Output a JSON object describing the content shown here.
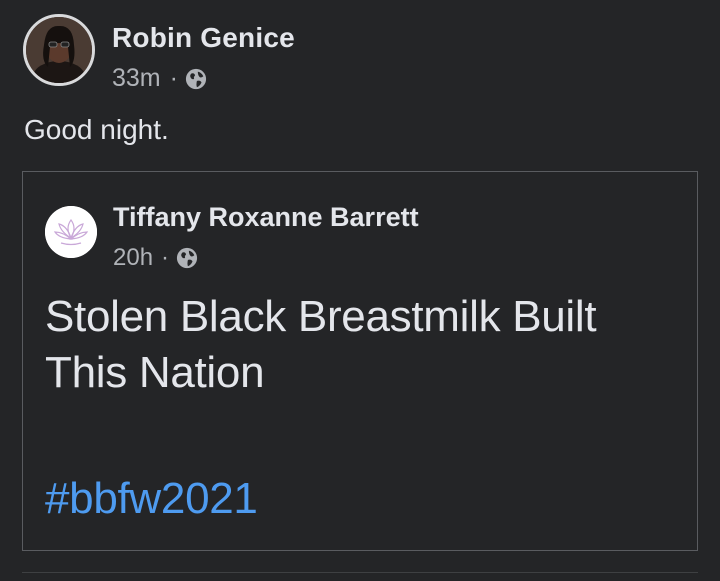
{
  "post": {
    "author": "Robin Genice",
    "time": "33m",
    "separator": "·",
    "privacy_icon": "globe-icon",
    "text": "Good night."
  },
  "shared_post": {
    "author": "Tiffany Roxanne Barrett",
    "time": "20h",
    "separator": "·",
    "privacy_icon": "globe-icon",
    "text": "Stolen Black Breastmilk Built This Nation",
    "hashtag": "#bbfw2021"
  },
  "colors": {
    "background": "#242527",
    "text_primary": "#e4e6eb",
    "text_secondary": "#b0b3b8",
    "hashtag": "#4e9bf0",
    "border": "#5a5c60"
  }
}
